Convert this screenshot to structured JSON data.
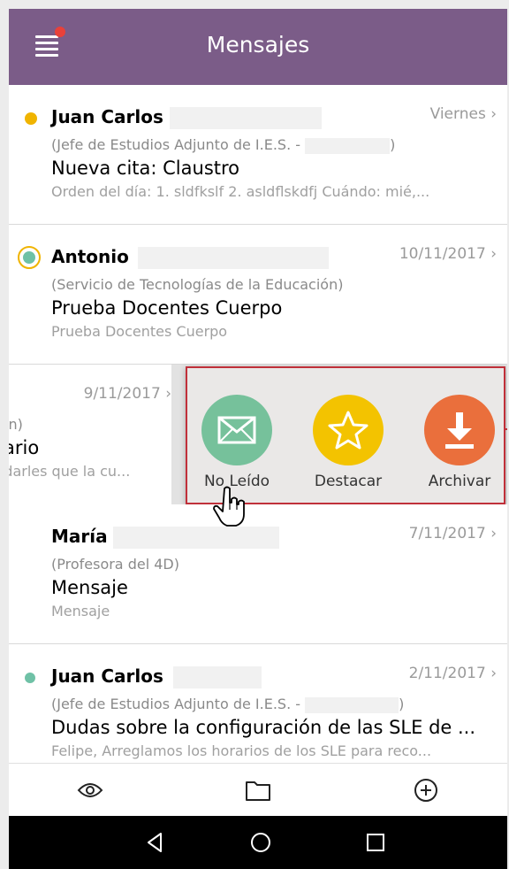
{
  "app_title": "Mensajes",
  "messages": [
    {
      "name": "Juan Carlos",
      "date": "Viernes ›",
      "sub": "(Jefe de Estudios Adjunto de I.E.S. - ",
      "sub_tail": ")",
      "subject": "Nueva cita: Claustro",
      "preview": "Orden del día:   1. sldfkslf 2. asldflskdfj Cuándo: mié,...",
      "indicator_color": "#f0b400"
    },
    {
      "name": "Antonio",
      "date": "10/11/2017 ›",
      "sub": "(Servicio de Tecnologías de la Educación)",
      "subject": "Prueba Docentes Cuerpo",
      "preview": "Prueba Docentes Cuerpo",
      "indicator_color": "#6fc1a6",
      "indicator_ring_color": "#f0b400"
    },
    {
      "date": "9/11/2017 ›",
      "sub": "ición)",
      "subject": "ario",
      "preview": "rdarles que la cu..."
    },
    {
      "name": "María",
      "date": "7/11/2017 ›",
      "sub": "(Profesora del 4D)",
      "subject": "Mensaje",
      "preview": "Mensaje"
    },
    {
      "name": "Juan Carlos",
      "date": "2/11/2017 ›",
      "sub": "(Jefe de Estudios Adjunto de I.E.S. - ",
      "sub_tail": ")",
      "subject": "Dudas sobre la configuración de las SLE de ...",
      "preview": "Felipe,  Arreglamos los horarios de los SLE para reco...",
      "indicator_color": "#6fc1a6"
    }
  ],
  "swipe_actions": [
    {
      "label": "No Leído",
      "icon": "envelope-icon",
      "color": "#76c19b"
    },
    {
      "label": "Destacar",
      "icon": "star-icon",
      "color": "#f3c300"
    },
    {
      "label": "Archivar",
      "icon": "download-icon",
      "color": "#ea6f3c"
    }
  ],
  "bottom_bar": [
    "eye-icon",
    "folder-icon",
    "plus-circle-icon"
  ],
  "colors": {
    "appbar": "#7b5c88",
    "highlight_border": "#c0303a",
    "notification_dot": "#e8413a"
  }
}
